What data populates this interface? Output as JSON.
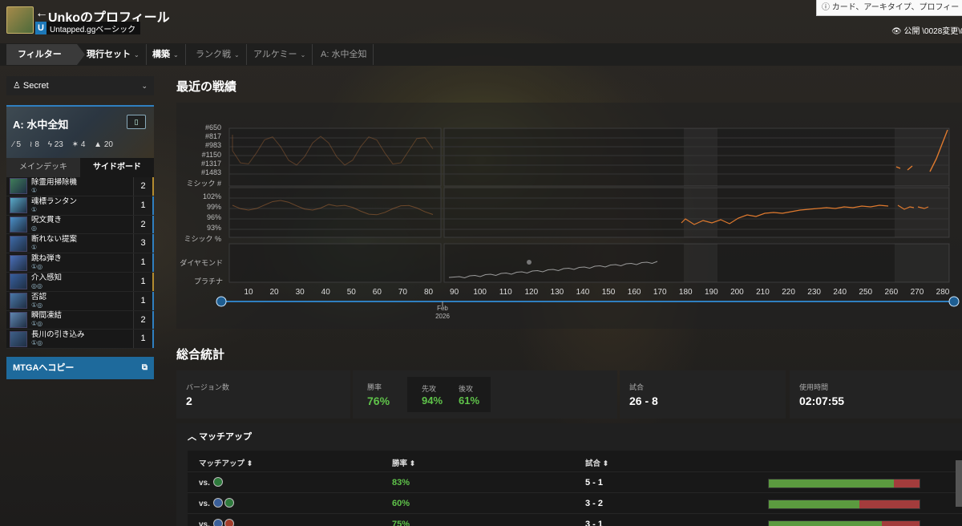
{
  "header": {
    "back_arrow": "←",
    "profile_title": "Unkoのプロフィール",
    "tier_letter": "U",
    "tier_label": "Untapped.ggベーシック",
    "search_placeholder": "ⓘ カード、アーキタイプ、プロフィー",
    "visibility": "👁 公開 \\0028変更\\0"
  },
  "filters": {
    "main_label": "フィルター",
    "chips": [
      {
        "label": "現行セット",
        "style": "bold",
        "chevron": true
      },
      {
        "label": "構築",
        "style": "bold",
        "chevron": true
      },
      {
        "label": "ランク戦",
        "style": "dim",
        "chevron": true
      },
      {
        "label": "アルケミー",
        "style": "dim",
        "chevron": true
      },
      {
        "label": "A: 水中全知",
        "style": "dim",
        "chevron": false
      }
    ]
  },
  "sidebar": {
    "deck_select": "Secret",
    "deck_name": "A: 水中全知",
    "deck_stats": [
      "5",
      "8",
      "23",
      "4",
      "20"
    ],
    "tabs": [
      "メインデッキ",
      "サイドボード"
    ],
    "active_tab": 1,
    "cards": [
      {
        "name": "除霊用掃除機",
        "mana": "①",
        "count": "2",
        "accent": "gold"
      },
      {
        "name": "魂標ランタン",
        "mana": "①",
        "count": "1",
        "accent": "blue"
      },
      {
        "name": "呪文貫き",
        "mana": "◎",
        "count": "2",
        "accent": "blue"
      },
      {
        "name": "断れない提案",
        "mana": "①",
        "count": "3",
        "accent": "blue"
      },
      {
        "name": "跳ね弾き",
        "mana": "①◎",
        "count": "1",
        "accent": "blue"
      },
      {
        "name": "介入感知",
        "mana": "◎◎",
        "count": "1",
        "accent": "gold"
      },
      {
        "name": "否認",
        "mana": "①◎",
        "count": "1",
        "accent": "blue"
      },
      {
        "name": "瞬間凍結",
        "mana": "①◎",
        "count": "2",
        "accent": "blue"
      },
      {
        "name": "長川の引き込み",
        "mana": "①◎",
        "count": "1",
        "accent": "blue"
      }
    ],
    "copy_button": "MTGAへコピー"
  },
  "recent": {
    "title": "最近の戦績",
    "mythic_rank_labels": [
      "#650",
      "#817",
      "#983",
      "#1150",
      "#1317",
      "#1483",
      "ミシック #"
    ],
    "mythic_pct_labels": [
      "102%",
      "99%",
      "96%",
      "93%",
      "ミシック %"
    ],
    "rank_labels": [
      "ダイヤモンド",
      "プラチナ"
    ],
    "x_ticks": [
      "10",
      "20",
      "30",
      "40",
      "50",
      "60",
      "70",
      "80",
      "90",
      "100",
      "110",
      "120",
      "130",
      "140",
      "150",
      "160",
      "170",
      "180",
      "190",
      "200",
      "210",
      "220",
      "230",
      "240",
      "250",
      "260",
      "270",
      "280"
    ],
    "date_marker": [
      "Feb",
      "2026"
    ]
  },
  "overall": {
    "title": "総合統計",
    "versions_label": "バージョン数",
    "versions_value": "2",
    "winrate_label": "勝率",
    "winrate_value": "76%",
    "first_label": "先攻",
    "first_value": "94%",
    "second_label": "後攻",
    "second_value": "61%",
    "games_label": "試合",
    "games_value": "26 - 8",
    "time_label": "使用時間",
    "time_value": "02:07:55"
  },
  "matchups": {
    "header": "マッチアップ",
    "col_matchup": "マッチアップ ⬍",
    "col_winrate": "勝率 ⬍",
    "col_games": "試合 ⬍",
    "rows": [
      {
        "vs": "vs.",
        "colors": [
          "green"
        ],
        "winrate": "83%",
        "games": "5 - 1",
        "win_fraction": 0.83
      },
      {
        "vs": "vs.",
        "colors": [
          "blue",
          "green"
        ],
        "winrate": "60%",
        "games": "3 - 2",
        "win_fraction": 0.6
      },
      {
        "vs": "vs.",
        "colors": [
          "blue",
          "red"
        ],
        "winrate": "75%",
        "games": "3 - 1",
        "win_fraction": 0.75
      }
    ]
  }
}
